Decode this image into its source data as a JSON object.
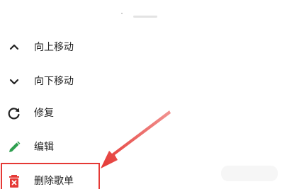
{
  "menu": {
    "items": [
      {
        "id": "move-up",
        "label": "向上移动",
        "icon": "chevron-up-icon"
      },
      {
        "id": "move-down",
        "label": "向下移动",
        "icon": "chevron-down-icon"
      },
      {
        "id": "repair",
        "label": "修复",
        "icon": "refresh-icon"
      },
      {
        "id": "edit",
        "label": "编辑",
        "icon": "pencil-icon"
      },
      {
        "id": "delete-playlist",
        "label": "删除歌单",
        "icon": "trash-icon"
      }
    ]
  },
  "colors": {
    "text": "#222222",
    "edit_icon": "#2e9f4f",
    "delete_icon": "#e53935",
    "annotation": "#e53935"
  }
}
